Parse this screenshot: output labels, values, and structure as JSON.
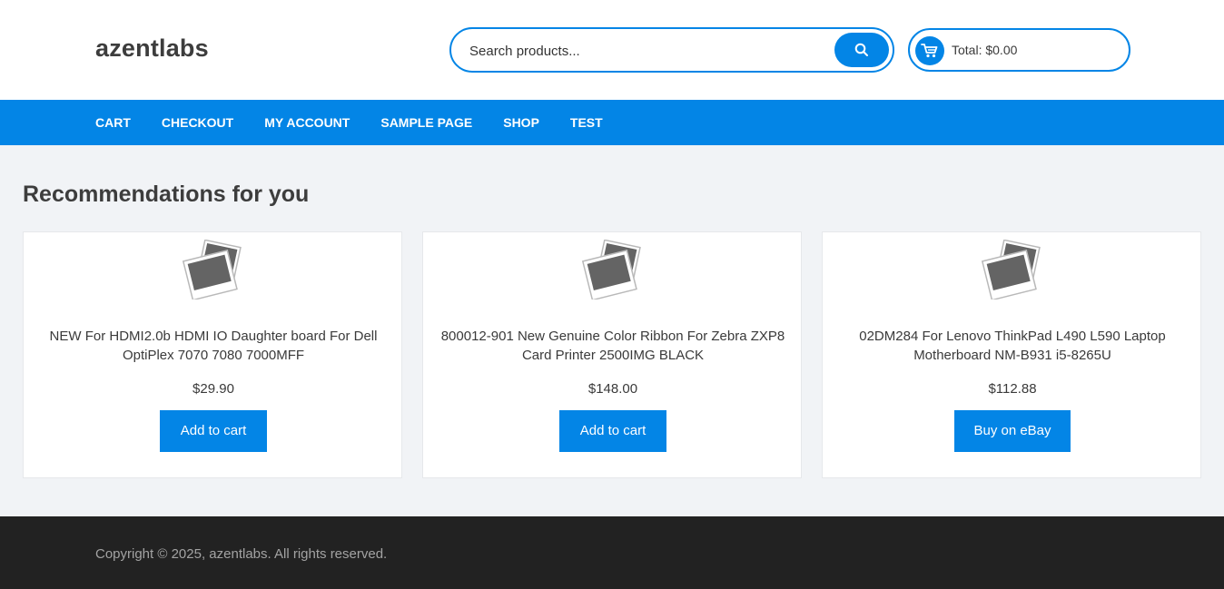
{
  "site": {
    "logo": "azentlabs"
  },
  "search": {
    "placeholder": "Search products..."
  },
  "cart": {
    "total_label": "Total: $0.00"
  },
  "nav": {
    "items": [
      "CART",
      "CHECKOUT",
      "MY ACCOUNT",
      "SAMPLE PAGE",
      "SHOP",
      "TEST"
    ]
  },
  "recommendations": {
    "title": "Recommendations for you",
    "products": [
      {
        "title": "NEW For HDMI2.0b HDMI IO Daughter board For Dell OptiPlex 7070 7080 7000MFF",
        "price": "$29.90",
        "button": "Add to cart"
      },
      {
        "title": "800012-901 New Genuine Color Ribbon For Zebra ZXP8 Card Printer 2500IMG BLACK",
        "price": "$148.00",
        "button": "Add to cart"
      },
      {
        "title": "02DM284 For Lenovo ThinkPad L490 L590 Laptop Motherboard NM-B931 i5-8265U",
        "price": "$112.88",
        "button": "Buy on eBay"
      }
    ]
  },
  "footer": {
    "copyright": "Copyright © 2025, azentlabs. All rights reserved."
  },
  "colors": {
    "accent": "#0385e6",
    "footer_bg": "#222222",
    "page_bg": "#f1f3f6"
  },
  "icons": {
    "search": "search-icon",
    "cart": "cart-icon",
    "product_image": "image-placeholder-icon"
  }
}
